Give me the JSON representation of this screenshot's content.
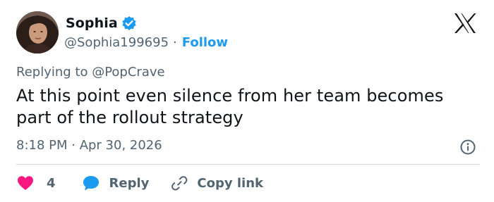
{
  "author": {
    "display_name": "Sophia",
    "handle": "@Sophia199695",
    "separator": "·",
    "follow_label": "Follow",
    "verified": true
  },
  "platform_icon": "x-logo-icon",
  "replying_to": "Replying to @PopCrave",
  "body": "At this point even silence from her team becomes part of the rollout strategy",
  "timestamp": "8:18 PM · Apr 30, 2026",
  "actions": {
    "likes": {
      "icon": "heart-icon",
      "count": "4"
    },
    "reply": {
      "icon": "speech-bubble-icon",
      "label": "Reply"
    },
    "copy_link": {
      "icon": "link-icon",
      "label": "Copy link"
    }
  },
  "colors": {
    "accent": "#1d9bf0",
    "like": "#f91880",
    "text": "#0f1419",
    "muted": "#536471",
    "divider": "#cfd9de"
  }
}
